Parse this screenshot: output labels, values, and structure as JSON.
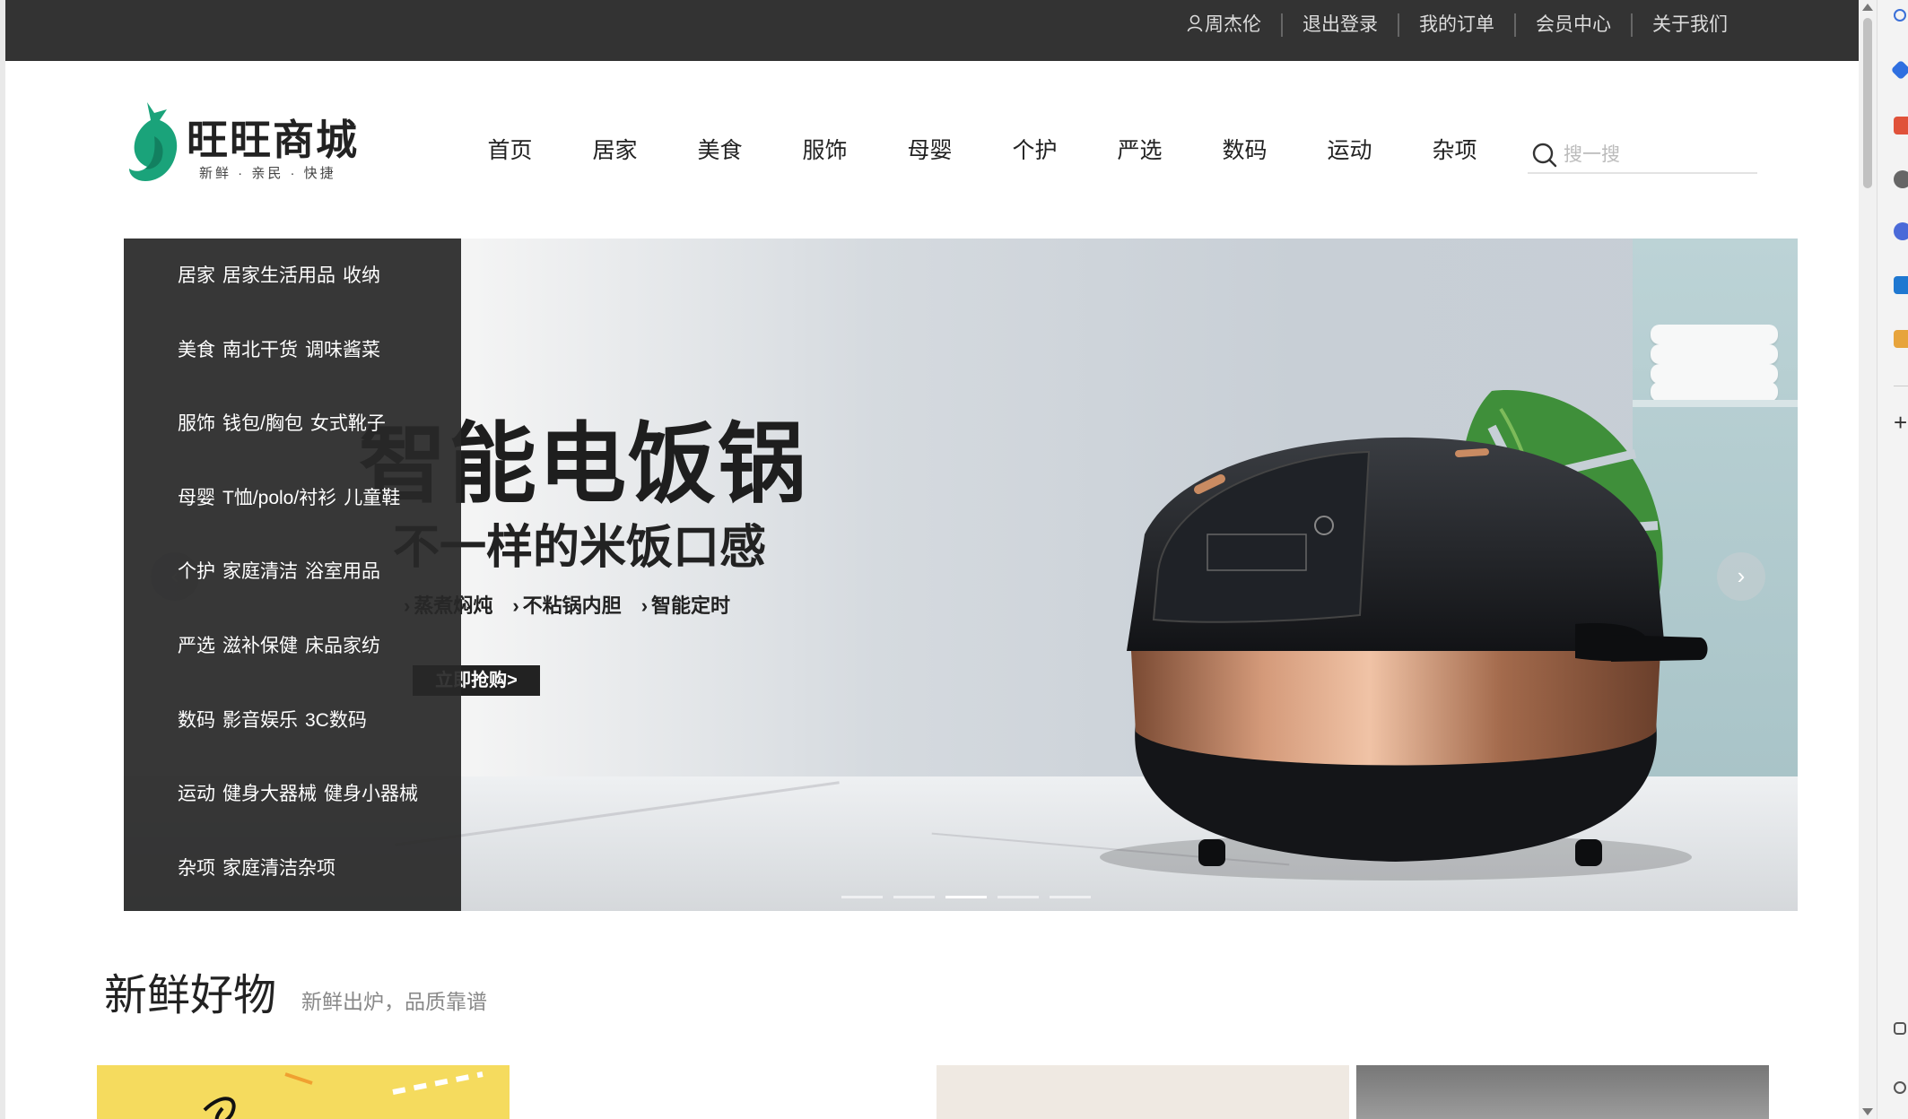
{
  "topbar": {
    "user": "周杰伦",
    "logout": "退出登录",
    "orders": "我的订单",
    "member": "会员中心",
    "about": "关于我们"
  },
  "logo": {
    "name": "旺旺商城",
    "slogan": "新鲜 · 亲民 · 快捷",
    "brand_color": "#1aa37a"
  },
  "nav": [
    "首页",
    "居家",
    "美食",
    "服饰",
    "母婴",
    "个护",
    "严选",
    "数码",
    "运动",
    "杂项"
  ],
  "search": {
    "placeholder": "搜一搜"
  },
  "categories": [
    {
      "name": "居家",
      "subs": [
        "居家生活用品",
        "收纳"
      ]
    },
    {
      "name": "美食",
      "subs": [
        "南北干货",
        "调味酱菜"
      ]
    },
    {
      "name": "服饰",
      "subs": [
        "钱包/胸包",
        "女式靴子"
      ]
    },
    {
      "name": "母婴",
      "subs": [
        "T恤/polo/衬衫",
        "儿童鞋"
      ]
    },
    {
      "name": "个护",
      "subs": [
        "家庭清洁",
        "浴室用品"
      ]
    },
    {
      "name": "严选",
      "subs": [
        "滋补保健",
        "床品家纺"
      ]
    },
    {
      "name": "数码",
      "subs": [
        "影音娱乐",
        "3C数码"
      ]
    },
    {
      "name": "运动",
      "subs": [
        "健身大器械",
        "健身小器械"
      ]
    },
    {
      "name": "杂项",
      "subs": [
        "家庭清洁杂项"
      ]
    }
  ],
  "banner": {
    "headline": "智能电饭锅",
    "subline": "不一样的米饭口感",
    "features": [
      "蒸煮焖炖",
      "不粘锅内胆",
      "智能定时"
    ],
    "button": "立即抢购>",
    "prev_icon": "chevron-left-icon",
    "next_icon": "chevron-right-icon",
    "next_symbol": "›",
    "prev_symbol": "‹",
    "slide_count": 5,
    "active_slide": 3
  },
  "section": {
    "title": "新鲜好物",
    "desc": "新鲜出炉，品质靠谱"
  },
  "colors": {
    "topbar_bg": "#333333",
    "category_bg": "#282828",
    "accent": "#1aa37a"
  }
}
